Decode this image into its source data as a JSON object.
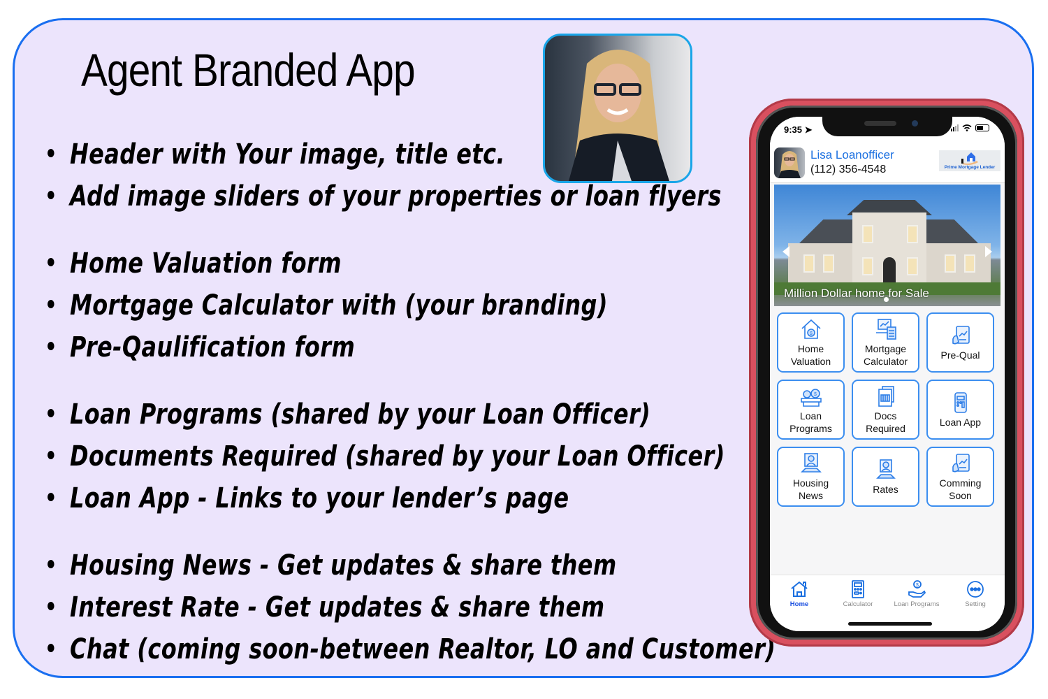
{
  "slide": {
    "title": "Agent Branded App",
    "bullets": [
      "Header with Your image, title etc.",
      "Add image sliders of your properties or loan flyers",
      "Home Valuation form",
      "Mortgage Calculator with (your branding)",
      "Pre-Qaulification form",
      "Loan Programs (shared by your Loan Officer)",
      "Documents Required (shared by your Loan Officer)",
      "Loan App - Links to your lender’s page",
      "Housing News - Get updates & share them",
      "Interest Rate - Get updates & share them",
      "Chat (coming soon-between Realtor, LO and Customer)"
    ],
    "photo_icon": "agent-portrait-photo"
  },
  "colors": {
    "card_bg": "#ece4fc",
    "card_border": "#1a6ff0",
    "photo_border": "#1aa5e8",
    "phone_case": "#d9505f",
    "accent_blue": "#3b8ef0",
    "name_blue": "#1a6fe0"
  },
  "phone": {
    "status": {
      "time": "9:35",
      "location_icon": "location-arrow-icon",
      "signal_icon": "signal-icon",
      "wifi_icon": "wifi-icon",
      "battery_icon": "battery-icon"
    },
    "header": {
      "name": "Lisa Loanofficer",
      "phone": "(112) 356-4548",
      "lender_logo_text": "Prime Mortgage Lender"
    },
    "slider": {
      "caption": "Million Dollar home for Sale"
    },
    "tiles": [
      {
        "label": "Home\nValuation",
        "icon": "house-money-icon"
      },
      {
        "label": "Mortgage\nCalculator",
        "icon": "calculator-laptop-icon"
      },
      {
        "label": "Pre-Qual",
        "icon": "clipboard-chart-icon"
      },
      {
        "label": "Loan\nPrograms",
        "icon": "money-bags-icon"
      },
      {
        "label": "Docs\nRequired",
        "icon": "documents-icon"
      },
      {
        "label": "Loan App",
        "icon": "mobile-app-icon"
      },
      {
        "label": "Housing\nNews",
        "icon": "news-presenter-icon"
      },
      {
        "label": "Rates",
        "icon": "rates-presenter-icon"
      },
      {
        "label": "Comming\nSoon",
        "icon": "clipboard-chart-icon"
      }
    ],
    "tabs": [
      {
        "label": "Home",
        "icon": "home-icon",
        "active": true
      },
      {
        "label": "Calculator",
        "icon": "calculator-icon",
        "active": false
      },
      {
        "label": "Loan Programs",
        "icon": "dollar-hand-icon",
        "active": false
      },
      {
        "label": "Setting",
        "icon": "more-dots-icon",
        "active": false
      }
    ]
  }
}
